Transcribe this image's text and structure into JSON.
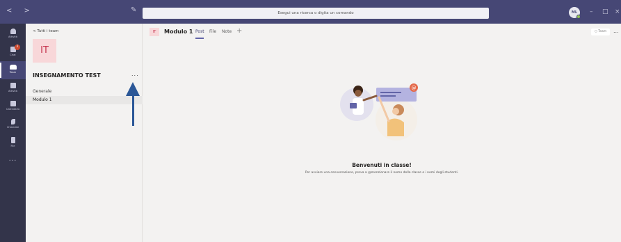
{
  "titlebar": {
    "search_placeholder": "Esegui una ricerca o digita un comando",
    "user_initials": "ML",
    "nav_arrows": "< >",
    "minimize": "–",
    "maximize": "□",
    "close": "×"
  },
  "rail": {
    "items": [
      {
        "label": "Attività",
        "icon": "bell-icon"
      },
      {
        "label": "Chat",
        "icon": "chat-icon",
        "badge": "2"
      },
      {
        "label": "Team",
        "icon": "team-icon",
        "active": true
      },
      {
        "label": "Attività",
        "icon": "assignment-icon"
      },
      {
        "label": "Calendario",
        "icon": "calendar-icon"
      },
      {
        "label": "Chiamate",
        "icon": "phone-icon"
      },
      {
        "label": "File",
        "icon": "file-icon"
      }
    ],
    "more": "..."
  },
  "sidebar": {
    "back_label": "Tutti i team",
    "team_tile": "IT",
    "team_name": "INSEGNAMENTO TEST",
    "more": "...",
    "channels": [
      {
        "label": "Generale"
      },
      {
        "label": "Modulo 1",
        "active": true
      }
    ]
  },
  "channel_header": {
    "tile": "IT",
    "title": "Modulo 1",
    "tabs": [
      {
        "label": "Post",
        "active": true
      },
      {
        "label": "File"
      },
      {
        "label": "Note"
      }
    ],
    "add_tab": "+",
    "team_button": "Team",
    "more": "..."
  },
  "welcome": {
    "title": "Benvenuti in classe!",
    "subtitle": "Per avviare una conversazione, prova a @menzionare il nome della classe o i nomi degli studenti."
  },
  "colors": {
    "titlebar": "#464775",
    "rail": "#33344a",
    "accent": "#6264a7",
    "tile_bg": "#f8d7d9",
    "tile_fg": "#c4314b",
    "arrow": "#2b5797"
  }
}
